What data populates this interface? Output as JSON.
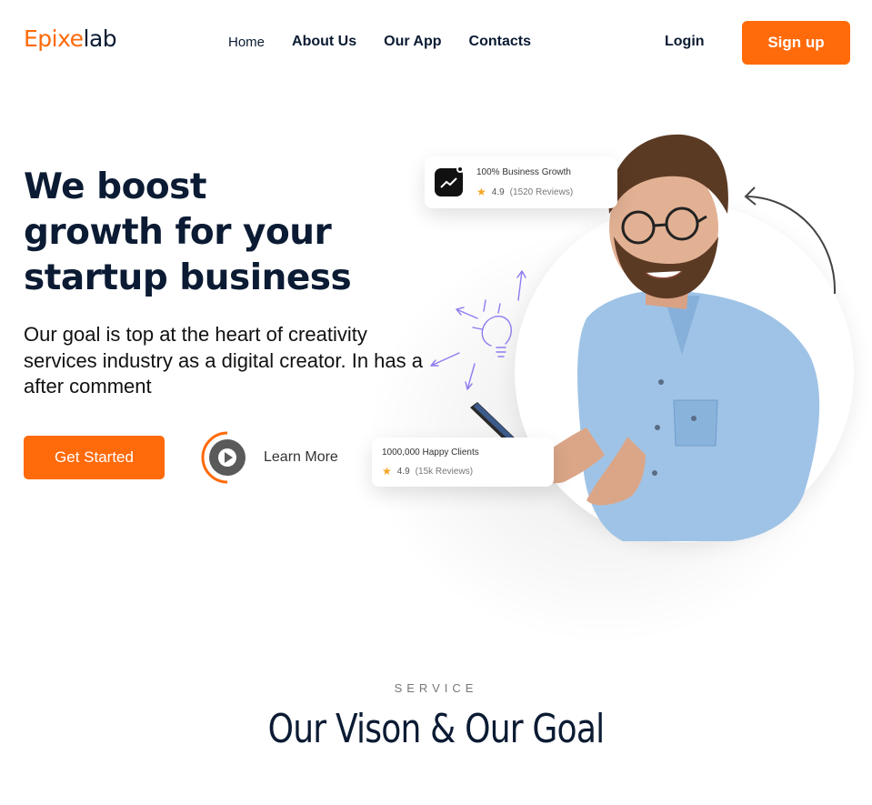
{
  "header": {
    "logo_part1": "Epixe",
    "logo_part2": "lab",
    "nav": [
      {
        "label": "Home"
      },
      {
        "label": "About Us"
      },
      {
        "label": "Our App"
      },
      {
        "label": "Contacts"
      }
    ],
    "login_label": "Login",
    "signup_label": "Sign up"
  },
  "hero": {
    "title_line1": "We boost",
    "title_line2": "growth for your",
    "title_line3": "startup business",
    "subtitle": "Our goal is top at the heart of creativity services industry as a digital creator. In has a after comment",
    "cta_label": "Get Started",
    "learn_more_label": "Learn More"
  },
  "cards": {
    "growth": {
      "title": "100% Business Growth",
      "rating": "4.9",
      "reviews": "(1520 Reviews)"
    },
    "clients": {
      "title": "1000,000 Happy Clients",
      "rating": "4.9",
      "reviews": "(15k Reviews)"
    }
  },
  "service": {
    "label": "SERVICE",
    "title": "Our Vison & Our Goal"
  },
  "colors": {
    "accent": "#ff6a0a",
    "navy": "#0b1b33"
  }
}
